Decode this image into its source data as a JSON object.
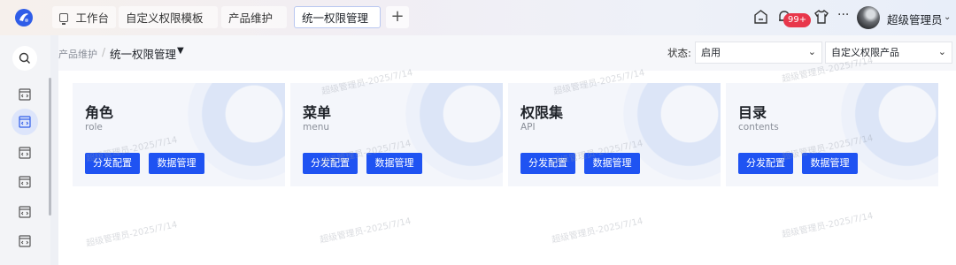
{
  "topbar": {
    "tabs": [
      {
        "label": "工作台",
        "icon": "monitor-icon"
      },
      {
        "label": "自定义权限模板"
      },
      {
        "label": "产品维护"
      },
      {
        "label": "统一权限管理"
      }
    ],
    "badge_count": "99+",
    "username": "超级管理员"
  },
  "breadcrumb": {
    "parent": "产品维护",
    "current": "统一权限管理"
  },
  "filters": {
    "status_label": "状态:",
    "status_value": "启用",
    "product_value": "自定义权限产品"
  },
  "cards": [
    {
      "title": "角色",
      "subtitle": "role",
      "btn_distribute": "分发配置",
      "btn_data": "数据管理"
    },
    {
      "title": "菜单",
      "subtitle": "menu",
      "btn_distribute": "分发配置",
      "btn_data": "数据管理"
    },
    {
      "title": "权限集",
      "subtitle": "API",
      "btn_distribute": "分发配置",
      "btn_data": "数据管理"
    },
    {
      "title": "目录",
      "subtitle": "contents",
      "btn_distribute": "分发配置",
      "btn_data": "数据管理"
    }
  ],
  "watermark": "超级管理员-2025/7/14",
  "colors": {
    "primary": "#1f53f2",
    "badge": "#e8374b",
    "card_bg": "#f4f6fb"
  }
}
